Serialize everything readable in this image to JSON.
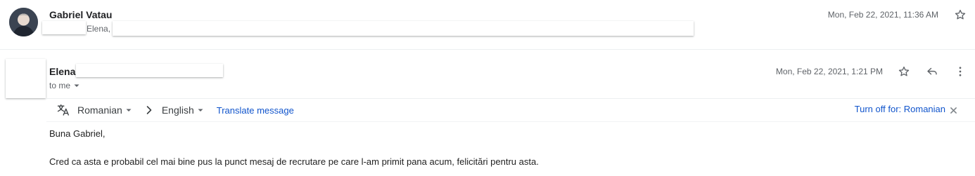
{
  "message1": {
    "sender": "Gabriel Vatau",
    "snippet_name": "Elena,",
    "date": "Mon, Feb 22, 2021, 11:36 AM"
  },
  "message2": {
    "sender": "Elena",
    "recipient_label": "to me",
    "date": "Mon, Feb 22, 2021, 1:21 PM"
  },
  "translate": {
    "source_language": "Romanian",
    "target_language": "English",
    "translate_link": "Translate message",
    "turn_off_label": "Turn off for: Romanian"
  },
  "body": {
    "greeting": "Buna Gabriel,",
    "paragraph": "Cred ca asta e probabil cel mai bine pus la punct mesaj de recrutare pe care l-am primit pana acum, felicitări pentru asta."
  },
  "icons": {
    "avatar": "avatar",
    "star": "star-icon",
    "reply": "reply-icon",
    "more": "more-vert-icon",
    "translate": "translate-icon",
    "caret": "caret-down-icon",
    "chevron": "chevron-right-icon",
    "close": "close-icon"
  },
  "colors": {
    "link": "#1155cc",
    "text": "#202124",
    "muted": "#5f6368"
  }
}
